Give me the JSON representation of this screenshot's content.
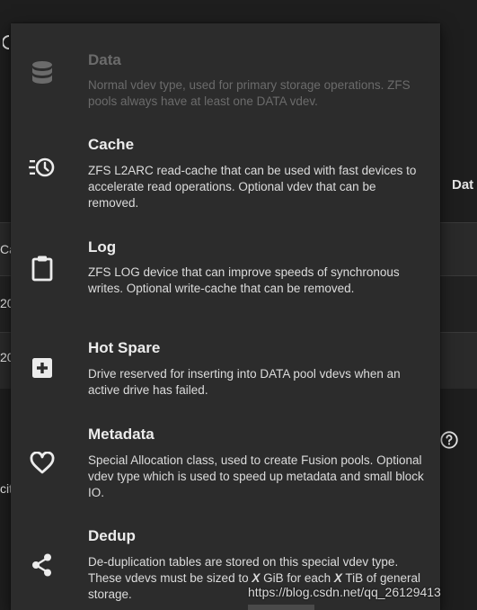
{
  "background": {
    "header_fragment": "Dat",
    "row_fragment_1": "Ca",
    "row_fragment_2": "20",
    "row_fragment_3": "20",
    "row_fragment_4": "cit",
    "help_icon": "help-circle-icon"
  },
  "menu": {
    "items": [
      {
        "title": "Data",
        "description": "Normal vdev type, used for primary storage operations. ZFS pools always have at least one DATA vdev.",
        "icon": "database-icon",
        "disabled": true
      },
      {
        "title": "Cache",
        "description": "ZFS L2ARC read-cache that can be used with fast devices to accelerate read operations. Optional vdev that can be removed.",
        "icon": "history-clock-icon",
        "disabled": false
      },
      {
        "title": "Log",
        "description": "ZFS LOG device that can improve speeds of synchronous writes. Optional write-cache that can be removed.",
        "icon": "clipboard-icon",
        "disabled": false
      },
      {
        "title": "Hot Spare",
        "description": "Drive reserved for inserting into DATA pool vdevs when an active drive has failed.",
        "icon": "plus-box-icon",
        "disabled": false
      },
      {
        "title": "Metadata",
        "description": "Special Allocation class, used to create Fusion pools. Optional vdev type which is used to speed up metadata and small block IO.",
        "icon": "heart-outline-icon",
        "disabled": false
      },
      {
        "title": "Dedup",
        "description": "De-duplication tables are stored on this special vdev type. These vdevs must be sized to X GiB for each X TiB of general storage.",
        "icon": "share-icon",
        "disabled": false
      }
    ]
  },
  "watermark": "https://blog.csdn.net/qq_26129413",
  "colors": {
    "menu_bg": "#2c2c2c",
    "page_bg": "#1e1e1e",
    "text": "#e6e6e6",
    "disabled": "#6b6b6b"
  }
}
